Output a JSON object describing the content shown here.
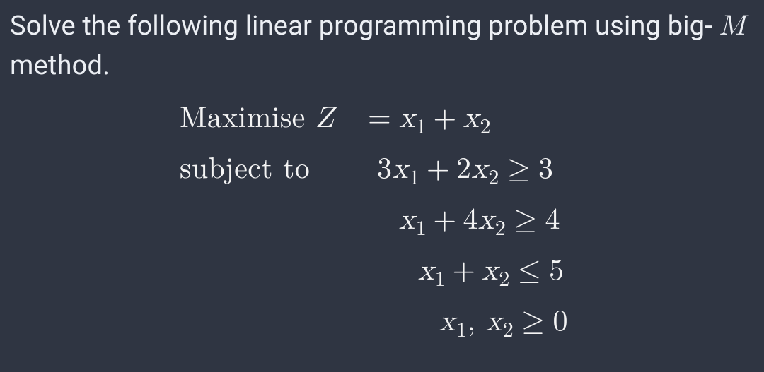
{
  "prompt": {
    "before": "Solve the following linear programming problem using big- ",
    "variable": "M",
    "after": " method."
  },
  "math": {
    "label_objective": "Maximise ",
    "label_constraints": "subject to",
    "Z": "Z",
    "x": "x",
    "sub1": "1",
    "sub2": "2",
    "eq": "=",
    "plus": "+",
    "ge": "≥",
    "le": "≤",
    "comma": ",",
    "c1": {
      "a": "3",
      "b": "2",
      "rhs": "3"
    },
    "c2": {
      "a": "",
      "b": "4",
      "rhs": "4"
    },
    "c3": {
      "rhs": "5"
    },
    "nn": {
      "rhs": "0"
    }
  }
}
